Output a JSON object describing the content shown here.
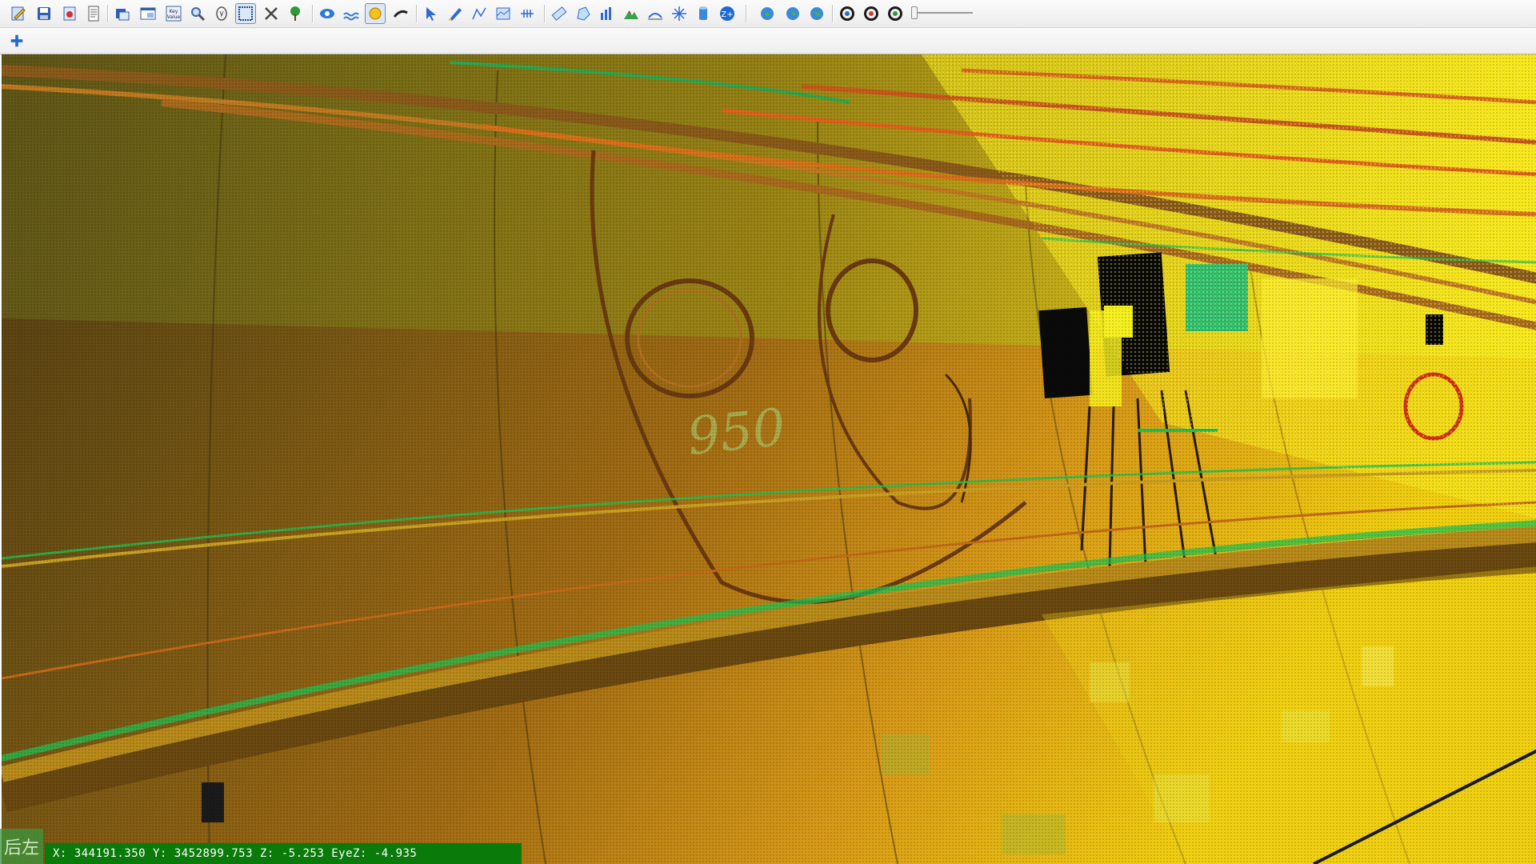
{
  "toolbar": {
    "main_icons": [
      "edit-icon",
      "save-icon",
      "export-icon",
      "report-icon",
      "layers-icon",
      "window-icon",
      "key-value-icon",
      "search-settings-icon",
      "filter-icon",
      "select-box-icon",
      "tools-icon",
      "tree-icon",
      "eye-icon",
      "water-icon",
      "sun-icon",
      "wand-icon",
      "cursor-icon",
      "pen-icon",
      "polyline-icon",
      "profile-icon",
      "grid-icon",
      "ruler-icon",
      "area-icon",
      "chart-icon",
      "terrain-icon",
      "surface-icon",
      "star-icon",
      "cylinder-icon",
      "zplus-icon",
      "globe-icon",
      "globe-refresh-icon",
      "globe-arrow-icon",
      "nav-circle-1-icon",
      "nav-circle-2-icon",
      "nav-circle-3-icon"
    ],
    "key_value_label": "Key Value",
    "zoom_slider_value": 0.0
  },
  "secondary_toolbar": {
    "add_icon": "plus-icon"
  },
  "viewport": {
    "overlay_text": "后左",
    "status": "X: 344191.350  Y: 3452899.753  Z: -5.253  EyeZ: -4.935",
    "wall_marking": "950"
  },
  "colors": {
    "status_bg": "#0a7a0a",
    "cloud_dark": "#6e4a14",
    "cloud_mid": "#b87a18",
    "cloud_bright": "#f2ea10",
    "cloud_green": "#22c050"
  }
}
